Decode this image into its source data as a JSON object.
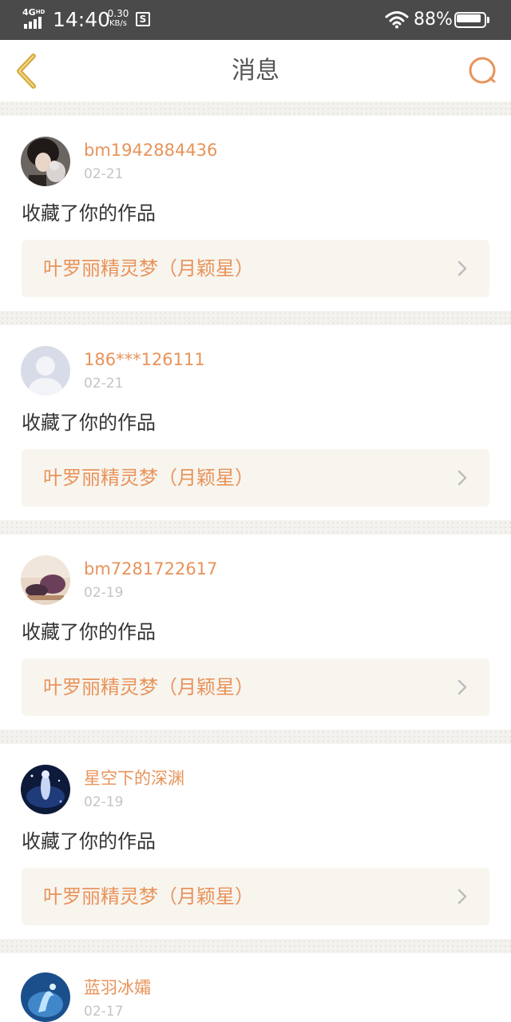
{
  "status_bar": {
    "network": "4G",
    "network_sup": "HD",
    "time": "14:40",
    "speed_value": "0.30",
    "speed_unit": "KB/s",
    "notification_icon": "S",
    "battery_percent": "88%",
    "battery_level": 0.88
  },
  "nav": {
    "title": "消息",
    "back_icon": "chevron-left-icon",
    "search_icon": "search-icon",
    "accent_color": "#e8935a",
    "back_color": "#d4a93a"
  },
  "messages": [
    {
      "username": "bm1942884436",
      "date": "02-21",
      "action": "收藏了你的作品",
      "work_title": "叶罗丽精灵梦（月颖星）",
      "avatar": "photo-avatar"
    },
    {
      "username": "186***126111",
      "date": "02-21",
      "action": "收藏了你的作品",
      "work_title": "叶罗丽精灵梦（月颖星）",
      "avatar": "default-user-avatar"
    },
    {
      "username": "bm7281722617",
      "date": "02-19",
      "action": "收藏了你的作品",
      "work_title": "叶罗丽精灵梦（月颖星）",
      "avatar": "photo-avatar"
    },
    {
      "username": "星空下的深渊",
      "date": "02-19",
      "action": "收藏了你的作品",
      "work_title": "叶罗丽精灵梦（月颖星）",
      "avatar": "photo-avatar"
    },
    {
      "username": "蓝羽冰孀",
      "date": "02-17",
      "avatar": "photo-avatar"
    }
  ]
}
